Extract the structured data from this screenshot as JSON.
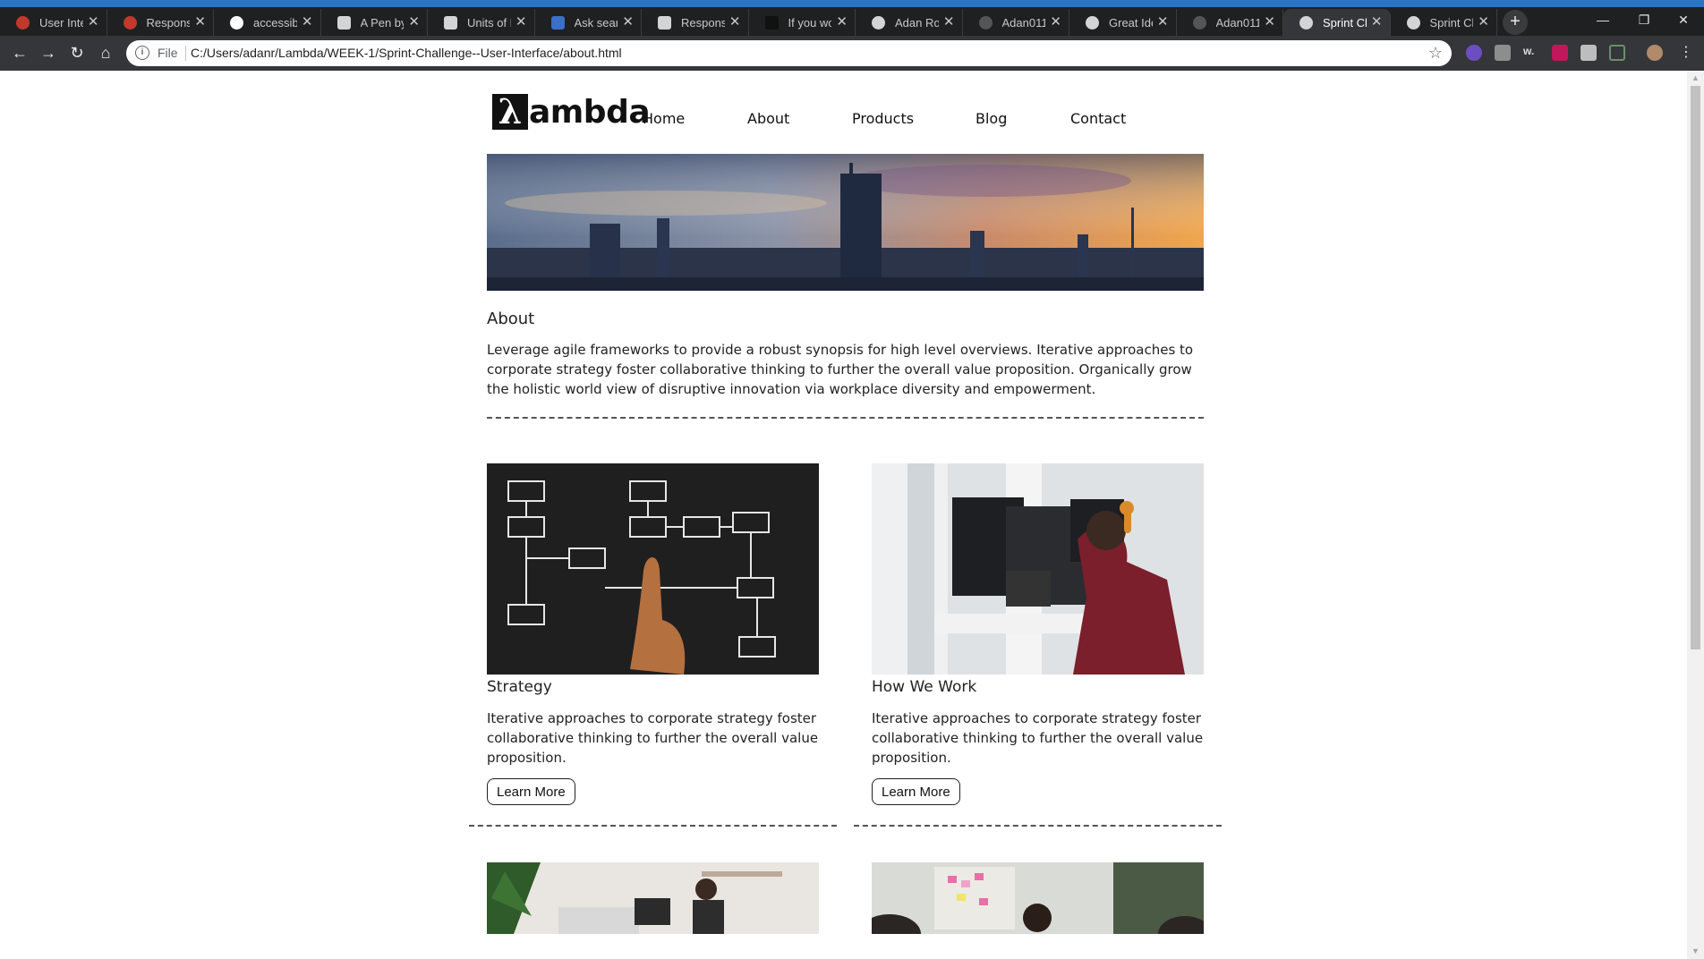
{
  "browser": {
    "tabs": [
      {
        "label": "User Interf",
        "active": false
      },
      {
        "label": "Responsive",
        "active": false
      },
      {
        "label": "accessibility",
        "active": false
      },
      {
        "label": "A Pen by",
        "active": false
      },
      {
        "label": "Units of M",
        "active": false
      },
      {
        "label": "Ask sears",
        "active": false
      },
      {
        "label": "Responsive",
        "active": false
      },
      {
        "label": "If you wo",
        "active": false
      },
      {
        "label": "Adan Rod",
        "active": false
      },
      {
        "label": "Adan011/",
        "active": false
      },
      {
        "label": "Great Idea",
        "active": false
      },
      {
        "label": "Adan011/",
        "active": false
      },
      {
        "label": "Sprint Cha",
        "active": true
      },
      {
        "label": "Sprint Cha",
        "active": false
      }
    ],
    "omnibox": {
      "scheme_label": "File",
      "url": "C:/Users/adanr/Lambda/WEEK-1/Sprint-Challenge--User-Interface/about.html"
    }
  },
  "site": {
    "logo": {
      "mark": "λ",
      "text": "ambda"
    },
    "nav": [
      "Home",
      "About",
      "Products",
      "Blog",
      "Contact"
    ],
    "about": {
      "heading": "About",
      "body": "Leverage agile frameworks to provide a robust synopsis for high level overviews. Iterative approaches to corporate strategy foster collaborative thinking to further the overall value proposition. Organically grow the holistic world view of disruptive innovation via workplace diversity and empowerment."
    },
    "cards": [
      {
        "title": "Strategy",
        "text": "Iterative approaches to corporate strategy foster collaborative thinking to further the overall value proposition.",
        "button": "Learn More"
      },
      {
        "title": "How We Work",
        "text": "Iterative approaches to corporate strategy foster collaborative thinking to further the overall value proposition.",
        "button": "Learn More"
      }
    ]
  },
  "colors": {
    "accent": "#2a74c6",
    "chrome_dark": "#1f2022",
    "toolbar": "#35363a"
  }
}
